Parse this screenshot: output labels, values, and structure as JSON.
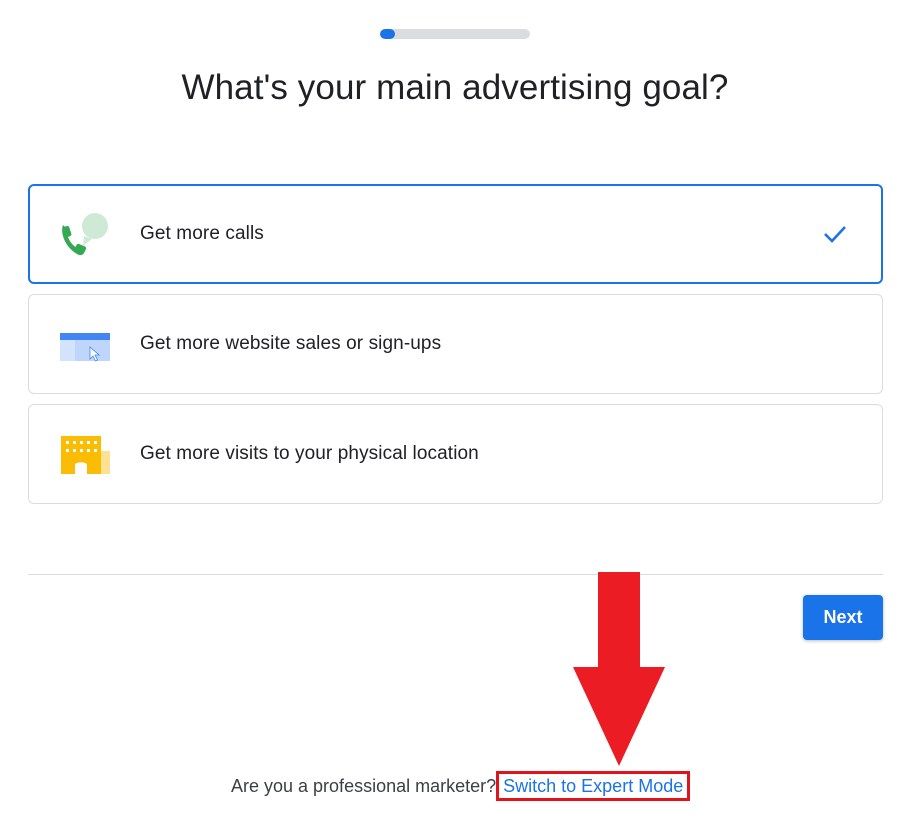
{
  "progress": {
    "fraction": 0.1
  },
  "title": "What's your main advertising goal?",
  "options": [
    {
      "label": "Get more calls",
      "icon": "phone-chat-icon",
      "selected": true
    },
    {
      "label": "Get more website sales or sign-ups",
      "icon": "browser-cursor-icon",
      "selected": false
    },
    {
      "label": "Get more visits to your physical location",
      "icon": "storefront-icon",
      "selected": false
    }
  ],
  "next_button": {
    "label": "Next"
  },
  "footer": {
    "prompt": "Are you a professional marketer?",
    "link": "Switch to Expert Mode"
  },
  "colors": {
    "accent": "#1a73e8",
    "annotation_red": "#e0141c",
    "phone_green": "#34a853",
    "building_yellow": "#fbbc04"
  }
}
